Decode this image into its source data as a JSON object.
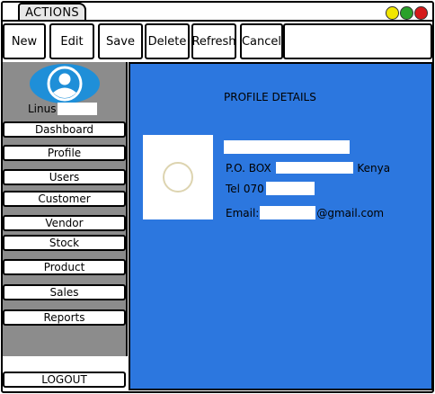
{
  "window": {
    "tab_label": "ACTIONS",
    "controls": [
      {
        "name": "minimize",
        "color": "#f2e600"
      },
      {
        "name": "maximize",
        "color": "#2aa12a"
      },
      {
        "name": "close",
        "color": "#d61a1a"
      }
    ]
  },
  "toolbar": {
    "new_label": "New",
    "edit_label": "Edit",
    "save_label": "Save",
    "delete_label": "Delete",
    "refresh_label": "Refresh",
    "cancel_label": "Cancel"
  },
  "sidebar": {
    "avatar_icon": "user-avatar-icon",
    "user_name": "Linus",
    "items": [
      {
        "label": "Dashboard"
      },
      {
        "label": "Profile"
      },
      {
        "label": "Users"
      },
      {
        "label": "Customer"
      },
      {
        "label": "Vendor"
      },
      {
        "label": "Stock"
      },
      {
        "label": "Product"
      },
      {
        "label": "Sales"
      },
      {
        "label": "Reports"
      }
    ],
    "logout_label": "LOGOUT"
  },
  "profile": {
    "heading": "PROFILE DETAILS",
    "address_prefix": "P.O. BOX",
    "address_suffix": "Kenya",
    "tel_prefix": "Tel 070",
    "email_prefix": "Email:",
    "email_suffix": "@gmail.com"
  },
  "colors": {
    "main_panel": "#2c77df",
    "sidebar_bg": "#8c8c8c",
    "avatar": "#1f8fd8"
  }
}
